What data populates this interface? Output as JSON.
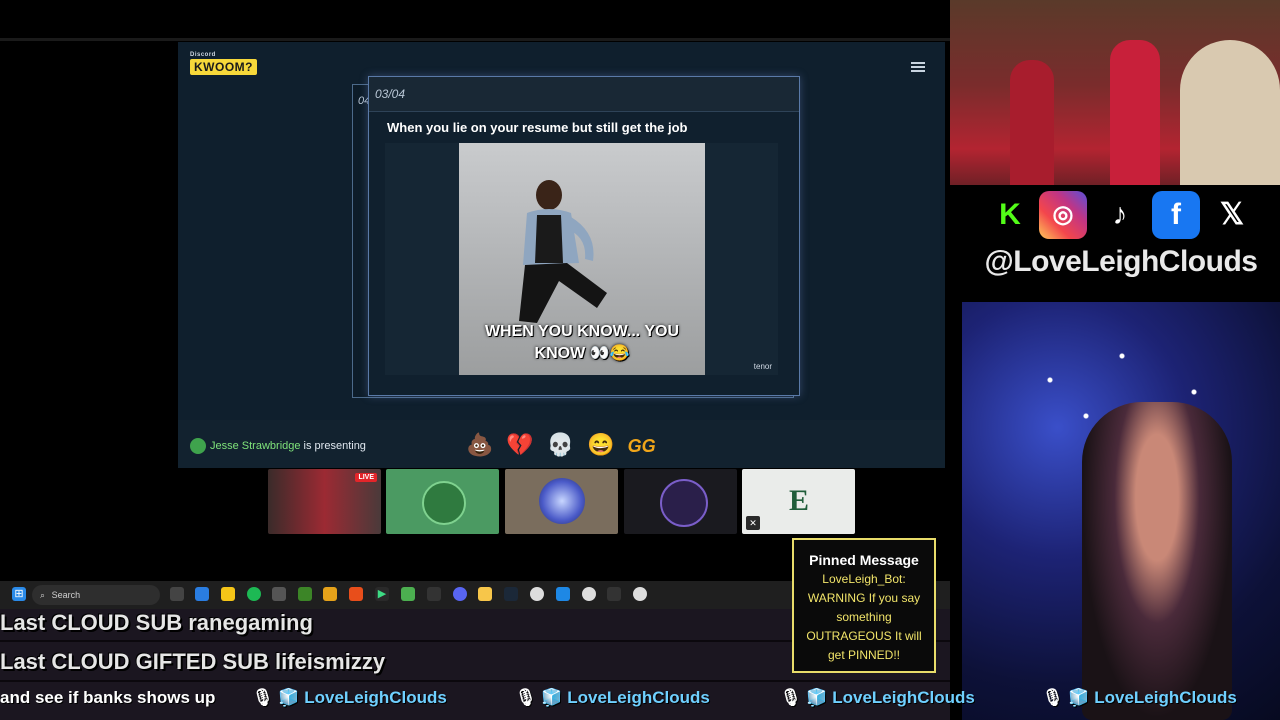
{
  "activity": {
    "logo_small": "Discord",
    "logo_main": "KWOOM?",
    "prev_card_number": "04",
    "card_number": "03/04",
    "caption": "When you lie on your resume but still get the job",
    "gif_caption_line1": "WHEN YOU KNOW... YOU",
    "gif_caption_line2": "KNOW 👀😂",
    "gif_credit": "tenor",
    "presenter_name": "Jesse Strawbridge",
    "presenter_suffix": " is presenting",
    "reactions": [
      "💩",
      "💔",
      "💀",
      "😄",
      "GG"
    ]
  },
  "tiles": {
    "live_badge": "LIVE"
  },
  "social": {
    "handle": "@LoveLeighClouds",
    "icons": [
      "kick-icon",
      "instagram-icon",
      "tiktok-icon",
      "facebook-icon",
      "x-icon"
    ]
  },
  "taskbar": {
    "search_placeholder": "Search"
  },
  "overlay": {
    "last_sub": "Last CLOUD SUB ranegaming",
    "last_gifted": "Last CLOUD GIFTED SUB lifeismizzy",
    "ticker_lead": "and see if banks shows up",
    "ticker_name": "LoveLeighClouds"
  },
  "pinned": {
    "title": "Pinned Message",
    "body": "LoveLeigh_Bot: WARNING If you say something OUTRAGEOUS It will get PINNED!!"
  },
  "colors": {
    "accent_yellow": "#f7d83a",
    "presenter_green": "#7fe37a",
    "ticker_blue": "#6fd0ff",
    "pinned_border": "#e8dc6a"
  }
}
